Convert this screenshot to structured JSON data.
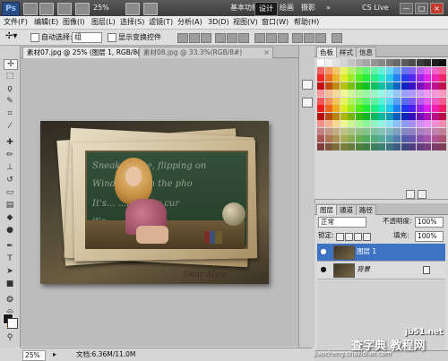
{
  "app": {
    "logo": "Ps",
    "zoom": "25%",
    "workspaces": [
      "基本功能",
      "设计",
      "绘画",
      "摄影"
    ],
    "active_workspace": "设计",
    "cs_live": "CS Live",
    "window_buttons": [
      "—",
      "□",
      "×"
    ]
  },
  "menu": {
    "items": [
      "文件(F)",
      "编辑(E)",
      "图像(I)",
      "图层(L)",
      "选择(S)",
      "滤镜(T)",
      "分析(A)",
      "3D(D)",
      "视图(V)",
      "窗口(W)",
      "帮助(H)"
    ]
  },
  "options": {
    "auto_select_label": "自动选择:",
    "auto_select_value": "组",
    "show_transform_label": "显示变换控件"
  },
  "documents": {
    "tabs": [
      {
        "label": "素材07.jpg @ 25% (图层 1, RGB/8) *",
        "active": true
      },
      {
        "label": "素材08.jpg @ 33.3%(RGB/8#)",
        "active": false
      }
    ],
    "close_glyph": "×"
  },
  "canvas": {
    "chalk_lines": [
      "Sneak...   ...ite, flipping on",
      "Wind...   ...e on the pho",
      "It's...   ...ng slow cur",
      "it's ...   ...mama"
    ],
    "signature": "Dear Alice"
  },
  "status": {
    "zoom": "25%",
    "doc_info": "文档:6.36M/11.0M"
  },
  "swatches": {
    "tabs": [
      "色板",
      "样式",
      "信息"
    ]
  },
  "layers": {
    "tabs": [
      "图层",
      "通道",
      "路径"
    ],
    "blend_mode": "正常",
    "opacity_label": "不透明度:",
    "opacity_value": "100%",
    "lock_label": "锁定:",
    "fill_label": "填充:",
    "fill_value": "100%",
    "items": [
      {
        "name": "图层 1",
        "selected": true
      },
      {
        "name": "背景",
        "selected": false,
        "locked": true
      }
    ],
    "eye_glyph": "●"
  },
  "watermark": {
    "site": "jb51.net",
    "brand": "查字典 教程网",
    "sub": "jiaocheng.chazidian.com"
  },
  "colors": {
    "selected_layer": "#3e73c4",
    "app_bar": "#3c3c3c",
    "chalkboard": "#2a4430"
  }
}
